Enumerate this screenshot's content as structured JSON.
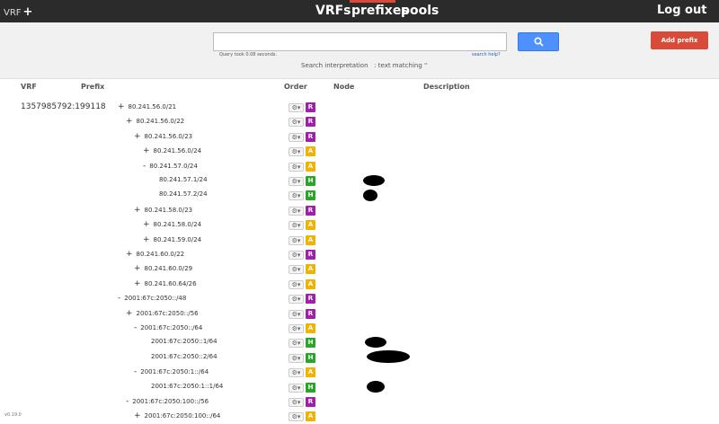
{
  "topbar": {
    "vrf_label": "VRF",
    "vrf_plus": "+",
    "nav": [
      "VRFs",
      "prefixes",
      "pools"
    ],
    "logout": "Log out",
    "active_color": "#d94a38"
  },
  "search": {
    "value": "",
    "button_icon": "search-icon",
    "query_time": "Query took 0.08 seconds.",
    "help": "search help?",
    "interpretation": "Search interpretation   : text matching ''",
    "add_prefix": "Add prefix"
  },
  "table": {
    "headers": {
      "vrf": "VRF",
      "prefix": "Prefix",
      "order": "Order",
      "node": "Node",
      "description": "Description"
    },
    "vrf_value": "1357985792:199118",
    "rows": [
      {
        "expander": "+",
        "prefix": "80.241.56.0/21",
        "type": "R"
      },
      {
        "expander": "+",
        "prefix": "80.241.56.0/22",
        "type": "R"
      },
      {
        "expander": "+",
        "prefix": "80.241.56.0/23",
        "type": "R"
      },
      {
        "expander": "+",
        "prefix": "80.241.56.0/24",
        "type": "A"
      },
      {
        "expander": "-",
        "prefix": "80.241.57.0/24",
        "type": "A"
      },
      {
        "expander": "",
        "prefix": "80.241.57.1/24",
        "type": "H"
      },
      {
        "expander": "",
        "prefix": "80.241.57.2/24",
        "type": "H"
      },
      {
        "expander": "+",
        "prefix": "80.241.58.0/23",
        "type": "R"
      },
      {
        "expander": "+",
        "prefix": "80.241.58.0/24",
        "type": "A"
      },
      {
        "expander": "+",
        "prefix": "80.241.59.0/24",
        "type": "A"
      },
      {
        "expander": "+",
        "prefix": "80.241.60.0/22",
        "type": "R"
      },
      {
        "expander": "+",
        "prefix": "80.241.60.0/29",
        "type": "A"
      },
      {
        "expander": "+",
        "prefix": "80.241.60.64/26",
        "type": "A"
      },
      {
        "expander": "-",
        "prefix": "2001:67c:2050::/48",
        "type": "R"
      },
      {
        "expander": "+",
        "prefix": "2001:67c:2050::/56",
        "type": "R"
      },
      {
        "expander": "-",
        "prefix": "2001:67c:2050::/64",
        "type": "A"
      },
      {
        "expander": "",
        "prefix": "2001:67c:2050::1/64",
        "type": "H"
      },
      {
        "expander": "",
        "prefix": "2001:67c:2050::2/64",
        "type": "H"
      },
      {
        "expander": "-",
        "prefix": "2001:67c:2050:1::/64",
        "type": "A"
      },
      {
        "expander": "",
        "prefix": "2001:67c:2050:1::1/64",
        "type": "H"
      },
      {
        "expander": "-",
        "prefix": "2001:67c:2050:100::/56",
        "type": "R"
      },
      {
        "expander": "+",
        "prefix": "2001:67c:2050:100::/64",
        "type": "A"
      }
    ],
    "type_colors": {
      "R": "#a020a8",
      "A": "#f0b400",
      "H": "#2aa52a"
    }
  },
  "footer": {
    "version": "v0.19.0"
  }
}
